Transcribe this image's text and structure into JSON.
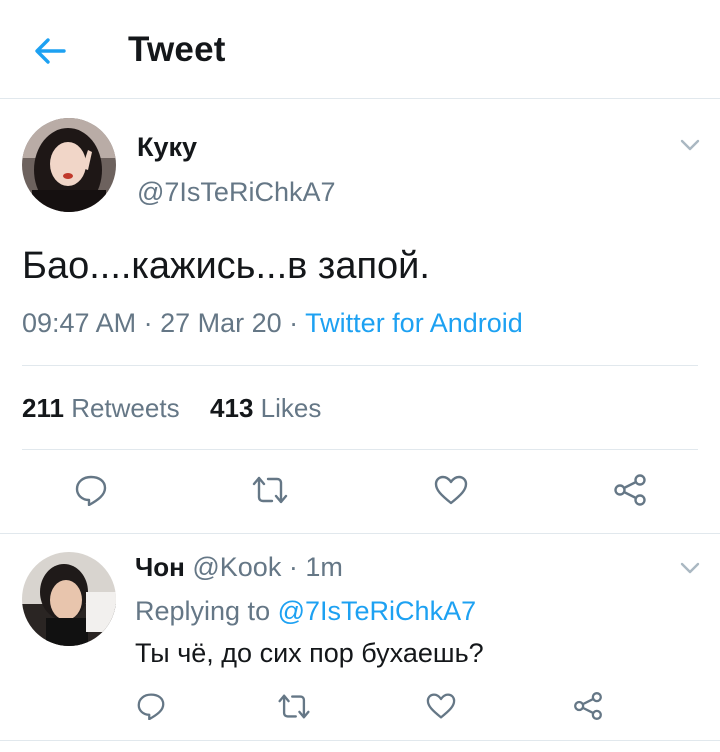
{
  "header": {
    "title": "Tweet"
  },
  "tweet": {
    "display_name": "Куку",
    "handle": "@7IsTeRiChkA7",
    "text": "Бао....кажись...в запой.",
    "time": "09:47 AM",
    "date": "27 Mar 20",
    "separator": " · ",
    "source": "Twitter for Android",
    "retweets_count": "211",
    "retweets_label": "Retweets",
    "likes_count": "413",
    "likes_label": "Likes"
  },
  "reply": {
    "display_name": "Чон",
    "handle": "@Kook",
    "age": "1m",
    "replying_prefix": "Replying to",
    "replying_to": "@7IsTeRiChkA7",
    "text": "Ты чё, до сих пор бухаешь?"
  },
  "colors": {
    "accent": "#1da1f2",
    "muted": "#657786",
    "text": "#14171a",
    "divider": "#e1e8ed"
  },
  "icons": [
    "back-arrow-icon",
    "chevron-down-icon",
    "reply-icon",
    "retweet-icon",
    "like-icon",
    "share-icon"
  ]
}
